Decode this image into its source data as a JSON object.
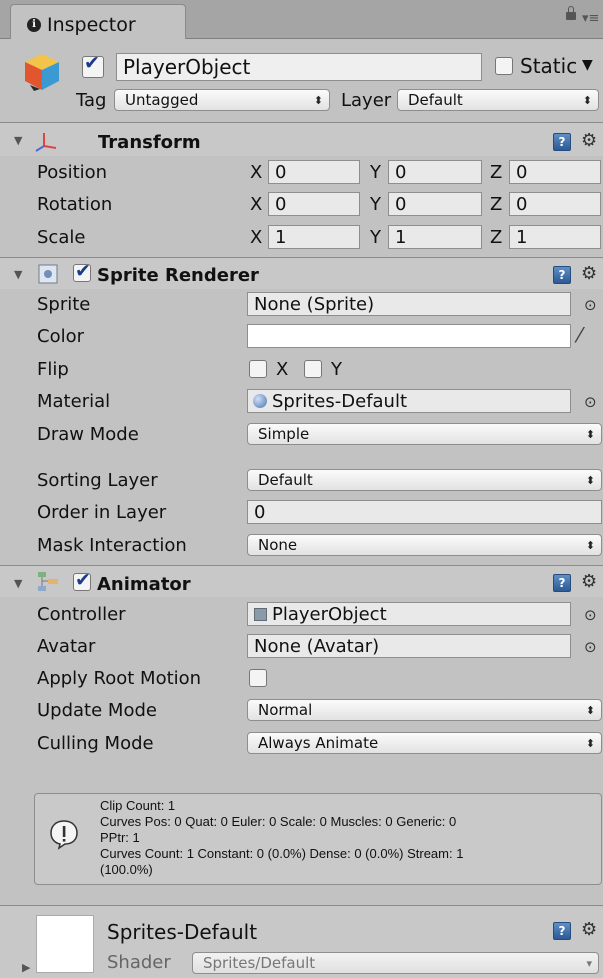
{
  "tab": {
    "label": "Inspector"
  },
  "object": {
    "name": "PlayerObject",
    "active": true,
    "static_label": "Static",
    "static": false,
    "tag_label": "Tag",
    "tag_value": "Untagged",
    "layer_label": "Layer",
    "layer_value": "Default"
  },
  "transform": {
    "title": "Transform",
    "rows": [
      {
        "label": "Position",
        "x": "0",
        "y": "0",
        "z": "0"
      },
      {
        "label": "Rotation",
        "x": "0",
        "y": "0",
        "z": "0"
      },
      {
        "label": "Scale",
        "x": "1",
        "y": "1",
        "z": "1"
      }
    ],
    "axis_x": "X",
    "axis_y": "Y",
    "axis_z": "Z"
  },
  "sprite_renderer": {
    "title": "Sprite Renderer",
    "enabled": true,
    "sprite_label": "Sprite",
    "sprite_value": "None (Sprite)",
    "color_label": "Color",
    "color_value": "#ffffff",
    "flip_label": "Flip",
    "flip_x_label": "X",
    "flip_y_label": "Y",
    "material_label": "Material",
    "material_value": "Sprites-Default",
    "draw_mode_label": "Draw Mode",
    "draw_mode_value": "Simple",
    "sorting_layer_label": "Sorting Layer",
    "sorting_layer_value": "Default",
    "order_label": "Order in Layer",
    "order_value": "0",
    "mask_label": "Mask Interaction",
    "mask_value": "None"
  },
  "animator": {
    "title": "Animator",
    "enabled": true,
    "controller_label": "Controller",
    "controller_value": "PlayerObject",
    "avatar_label": "Avatar",
    "avatar_value": "None (Avatar)",
    "root_motion_label": "Apply Root Motion",
    "root_motion": false,
    "update_label": "Update Mode",
    "update_value": "Normal",
    "culling_label": "Culling Mode",
    "culling_value": "Always Animate",
    "info": [
      "Clip Count: 1",
      "Curves Pos: 0 Quat: 0 Euler: 0 Scale: 0 Muscles: 0 Generic: 0",
      "PPtr: 1",
      "Curves Count: 1 Constant: 0 (0.0%) Dense: 0 (0.0%) Stream: 1",
      "(100.0%)"
    ]
  },
  "material": {
    "name": "Sprites-Default",
    "shader_label": "Shader",
    "shader_value": "Sprites/Default"
  },
  "icons": {
    "tab": "info-icon",
    "help": "help-book-icon",
    "settings": "gear-icon",
    "picker": "object-picker-icon",
    "eyedropper": "eyedropper-icon"
  }
}
